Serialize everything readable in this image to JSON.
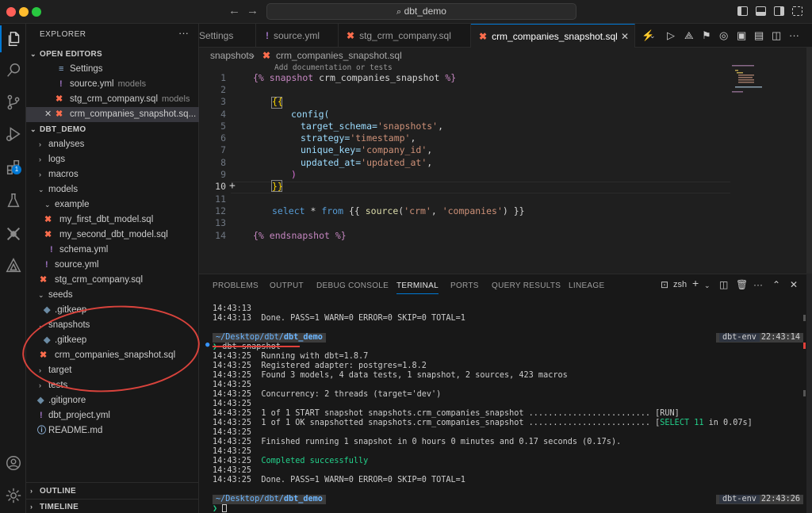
{
  "window": {
    "search_text": "dbt_demo"
  },
  "activity": {
    "items": [
      "files-icon",
      "search-icon",
      "source-control-icon",
      "run-debug-icon",
      "extensions-icon",
      "testing-icon",
      "dbt-icon",
      "power-user-icon"
    ],
    "extensions_badge": "1"
  },
  "sidebar": {
    "title": "EXPLORER",
    "more": "···",
    "open_editors_title": "OPEN EDITORS",
    "open_editors": [
      {
        "label": "Settings",
        "desc": ""
      },
      {
        "label": "source.yml",
        "desc": "models"
      },
      {
        "label": "stg_crm_company.sql",
        "desc": "models"
      },
      {
        "label": "crm_companies_snapshot.sq...",
        "desc": ""
      }
    ],
    "project_title": "DBT_DEMO",
    "tree": [
      {
        "label": "analyses"
      },
      {
        "label": "logs"
      },
      {
        "label": "macros"
      },
      {
        "label": "models"
      },
      {
        "label": "example"
      },
      {
        "label": "my_first_dbt_model.sql"
      },
      {
        "label": "my_second_dbt_model.sql"
      },
      {
        "label": "schema.yml"
      },
      {
        "label": "source.yml"
      },
      {
        "label": "stg_crm_company.sql"
      },
      {
        "label": "seeds"
      },
      {
        "label": ".gitkeep"
      },
      {
        "label": "snapshots"
      },
      {
        "label": ".gitkeep"
      },
      {
        "label": "crm_companies_snapshot.sql"
      },
      {
        "label": "target"
      },
      {
        "label": "tests"
      },
      {
        "label": ".gitignore"
      },
      {
        "label": "dbt_project.yml"
      },
      {
        "label": "README.md"
      }
    ],
    "outline": "OUTLINE",
    "timeline": "TIMELINE"
  },
  "tabs": [
    {
      "label": "Settings"
    },
    {
      "label": "source.yml"
    },
    {
      "label": "stg_crm_company.sql"
    },
    {
      "label": "crm_companies_snapshot.sql",
      "close": "✕"
    }
  ],
  "breadcrumbs": {
    "folder": "snapshots",
    "sep": "›",
    "file": "crm_companies_snapshot.sql"
  },
  "editor": {
    "codelens": "Add documentation or tests",
    "line_numbers": [
      "1",
      "2",
      "3",
      "4",
      "5",
      "6",
      "7",
      "8",
      "9",
      "10",
      "11",
      "12",
      "13",
      "14"
    ],
    "lines": {
      "l1a": "{% ",
      "l1b": "snapshot",
      "l1c": " crm_companies_snapshot ",
      "l1d": "%}",
      "l3": "{{",
      "l4": "config(",
      "l5a": "target_schema=",
      "l5b": "'snapshots'",
      "l5c": ",",
      "l6a": "strategy=",
      "l6b": "'timestamp'",
      "l6c": ",",
      "l7a": "unique_key=",
      "l7b": "'company_id'",
      "l7c": ",",
      "l8a": "updated_at=",
      "l8b": "'updated_at'",
      "l8c": ",",
      "l9": ")",
      "l10": "}}",
      "l12a": "select",
      "l12b": " * ",
      "l12c": "from",
      "l12d": " {{ ",
      "l12e": "source",
      "l12f": "(",
      "l12g": "'crm'",
      "l12h": ", ",
      "l12i": "'companies'",
      "l12j": ") }}",
      "l14a": "{% ",
      "l14b": "endsnapshot",
      "l14c": " %}"
    }
  },
  "panel": {
    "tabs": [
      "PROBLEMS",
      "OUTPUT",
      "DEBUG CONSOLE",
      "TERMINAL",
      "PORTS",
      "QUERY RESULTS",
      "LINEAGE"
    ],
    "shell": "zsh"
  },
  "terminal": {
    "pre1": "14:43:13",
    "pre2": "14:43:13  Done. PASS=1 WARN=0 ERROR=0 SKIP=0 TOTAL=1",
    "prompt_left_icons": "  ",
    "prompt_path": "~/Desktop/dbt/",
    "prompt_path_bold": "dbt_demo",
    "prompt_env": "dbt-env",
    "prompt_time1": "22:43:14",
    "prompt_time2": "22:43:26",
    "command_prefix": "❯ ",
    "command": "dbt snapshot",
    "lines": [
      "14:43:25  Running with dbt=1.8.7",
      "14:43:25  Registered adapter: postgres=1.8.2",
      "14:43:25  Found 3 models, 4 data tests, 1 snapshot, 2 sources, 423 macros",
      "14:43:25",
      "14:43:25  Concurrency: 2 threads (target='dev')",
      "14:43:25",
      "14:43:25  1 of 1 START snapshot snapshots.crm_companies_snapshot ......................... [RUN]"
    ],
    "ok_line_a": "14:43:25  1 of 1 OK snapshotted snapshots.crm_companies_snapshot ......................... [",
    "ok_line_b": "SELECT 11",
    "ok_line_c": " in 0.07s]",
    "lines2": [
      "14:43:25",
      "14:43:25  Finished running 1 snapshot in 0 hours 0 minutes and 0.17 seconds (0.17s)."
    ],
    "blank": "14:43:25",
    "completed_ts": "14:43:25  ",
    "completed": "Completed successfully",
    "blank2": "14:43:25",
    "done": "14:43:25  Done. PASS=1 WARN=0 ERROR=0 SKIP=0 TOTAL=1"
  },
  "colors": {
    "accent": "#0078d4",
    "dbt_orange": "#fe6d4d",
    "annotation_red": "#d9433c",
    "terminal_green": "#23d18b"
  }
}
